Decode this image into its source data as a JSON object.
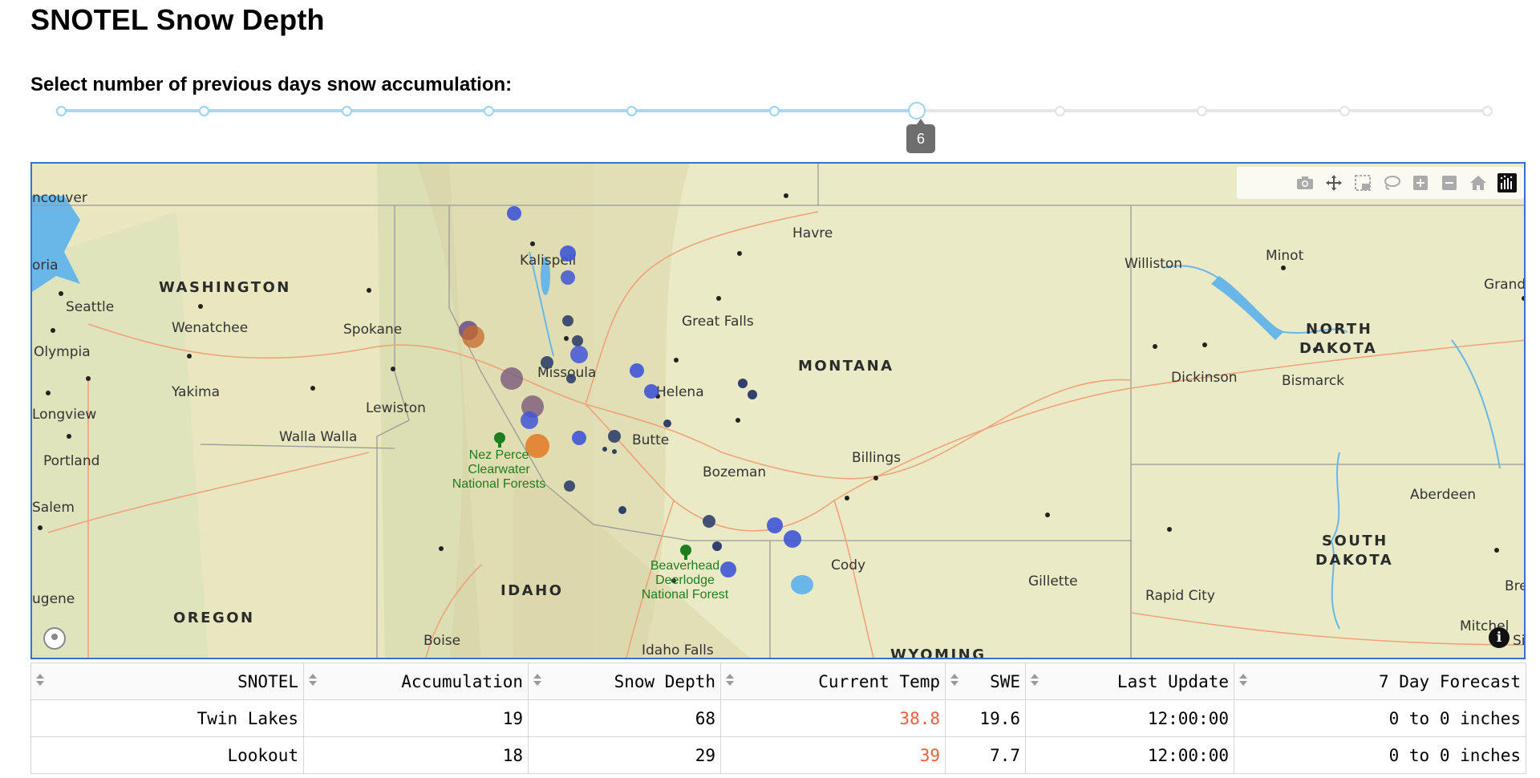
{
  "page_title": "SNOTEL Snow Depth",
  "slider": {
    "label": "Select number of previous days snow accumulation:",
    "value_label": "6",
    "value": 6,
    "min": 0,
    "max": 10
  },
  "map": {
    "places": {
      "vancouver": "ncouver",
      "victoria": "oria",
      "seattle": "Seattle",
      "olympia": "Olympia",
      "longview": "Longview",
      "portland": "Portland",
      "salem": "Salem",
      "eugene": "ugene",
      "wenatchee": "Wenatchee",
      "yakima": "Yakima",
      "spokane": "Spokane",
      "lewiston": "Lewiston",
      "walla_walla": "Walla Walla",
      "boise": "Boise",
      "idaho_falls": "Idaho Falls",
      "kalispell": "Kalispell",
      "missoula": "Missoula",
      "helena": "Helena",
      "butte": "Butte",
      "bozeman": "Bozeman",
      "great_falls": "Great Falls",
      "havre": "Havre",
      "billings": "Billings",
      "cody": "Cody",
      "gillette": "Gillette",
      "rapid_city": "Rapid City",
      "williston": "Williston",
      "minot": "Minot",
      "dickinson": "Dickinson",
      "bismarck": "Bismarck",
      "aberdeen": "Aberdeen",
      "mitchell": "Mitchel",
      "grand": "Grand",
      "bre": "Bre",
      "sio": "Sio"
    },
    "states": {
      "washington": "WASHINGTON",
      "oregon": "OREGON",
      "idaho": "IDAHO",
      "montana": "MONTANA",
      "wyoming": "WYOMING",
      "north_dakota_1": "NORTH",
      "north_dakota_2": "DAKOTA",
      "south_dakota_1": "SOUTH",
      "south_dakota_2": "DAKOTA"
    },
    "forests": {
      "nez_perce_1": "Nez Perce",
      "nez_perce_2": "Clearwater",
      "nez_perce_3": "National Forests",
      "beaverhead_1": "Beaverhead",
      "beaverhead_2": "Deerlodge",
      "beaverhead_3": "National Forest"
    },
    "modebar_icons": [
      "camera-icon",
      "pan-icon",
      "box-select-icon",
      "lasso-icon",
      "zoom-in-icon",
      "zoom-out-icon",
      "reset-home-icon",
      "plotly-logo-icon"
    ],
    "colors": {
      "cold": "#3f55d6",
      "dark": "#30406a",
      "warm": "#e07a22",
      "mid": "#7a5a7a",
      "water": "#69b6e8",
      "road": "#f0a27a"
    }
  },
  "table": {
    "headers": [
      "SNOTEL",
      "Accumulation",
      "Snow Depth",
      "Current Temp",
      "SWE",
      "Last Update",
      "7 Day Forecast"
    ],
    "rows": [
      [
        "Twin Lakes",
        "19",
        "68",
        "38.8",
        "19.6",
        "12:00:00",
        "0 to 0 inches"
      ],
      [
        "Lookout",
        "18",
        "29",
        "39",
        "7.7",
        "12:00:00",
        "0 to 0 inches"
      ]
    ]
  }
}
